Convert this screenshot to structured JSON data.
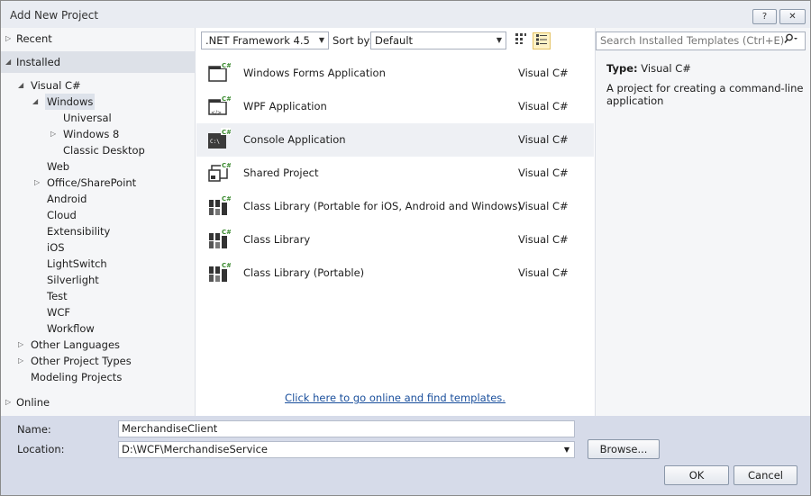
{
  "window": {
    "title": "Add New Project",
    "help_label": "?",
    "close_label": "✕"
  },
  "sidebar": {
    "recent_label": "Recent",
    "installed_label": "Installed",
    "online_label": "Online",
    "tree": [
      {
        "label": "Visual C#",
        "level": 1,
        "arrow": "◢"
      },
      {
        "label": "Windows",
        "level": 2,
        "arrow": "◢",
        "selected": true
      },
      {
        "label": "Universal",
        "level": 3
      },
      {
        "label": "Windows 8",
        "level": 3,
        "arrow": "▷"
      },
      {
        "label": "Classic Desktop",
        "level": 3
      },
      {
        "label": "Web",
        "level": 2
      },
      {
        "label": "Office/SharePoint",
        "level": 2,
        "arrow": "▷"
      },
      {
        "label": "Android",
        "level": 2
      },
      {
        "label": "Cloud",
        "level": 2
      },
      {
        "label": "Extensibility",
        "level": 2
      },
      {
        "label": "iOS",
        "level": 2
      },
      {
        "label": "LightSwitch",
        "level": 2
      },
      {
        "label": "Silverlight",
        "level": 2
      },
      {
        "label": "Test",
        "level": 2
      },
      {
        "label": "WCF",
        "level": 2
      },
      {
        "label": "Workflow",
        "level": 2
      },
      {
        "label": "Other Languages",
        "level": 1,
        "arrow": "▷"
      },
      {
        "label": "Other Project Types",
        "level": 1,
        "arrow": "▷"
      },
      {
        "label": "Modeling Projects",
        "level": 1
      }
    ]
  },
  "toolbar": {
    "framework": ".NET Framework 4.5",
    "sort_label": "Sort by:",
    "sort_value": "Default"
  },
  "templates": [
    {
      "name": "Windows Forms Application",
      "lang": "Visual C#",
      "icon": "windows-forms-icon"
    },
    {
      "name": "WPF Application",
      "lang": "Visual C#",
      "icon": "wpf-icon"
    },
    {
      "name": "Console Application",
      "lang": "Visual C#",
      "icon": "console-icon",
      "selected": true
    },
    {
      "name": "Shared Project",
      "lang": "Visual C#",
      "icon": "shared-project-icon"
    },
    {
      "name": "Class Library (Portable for iOS, Android and Windows)",
      "lang": "Visual C#",
      "icon": "class-library-icon"
    },
    {
      "name": "Class Library",
      "lang": "Visual C#",
      "icon": "class-library-icon"
    },
    {
      "name": "Class Library (Portable)",
      "lang": "Visual C#",
      "icon": "class-library-icon"
    }
  ],
  "online_link": "Click here to go online and find templates.",
  "search": {
    "placeholder": "Search Installed Templates (Ctrl+E)"
  },
  "details": {
    "type_label": "Type:",
    "type_value": "Visual C#",
    "description": "A project for creating a command-line application"
  },
  "form": {
    "name_label": "Name:",
    "name_value": "MerchandiseClient",
    "location_label": "Location:",
    "location_value": "D:\\WCF\\MerchandiseService",
    "browse_label": "Browse...",
    "ok_label": "OK",
    "cancel_label": "Cancel"
  },
  "colors": {
    "accent": "#1a4f9c",
    "dialog_bg": "#d6dbe9",
    "selection": "#dde2ea",
    "csharp_badge": "#3a8a2e"
  }
}
